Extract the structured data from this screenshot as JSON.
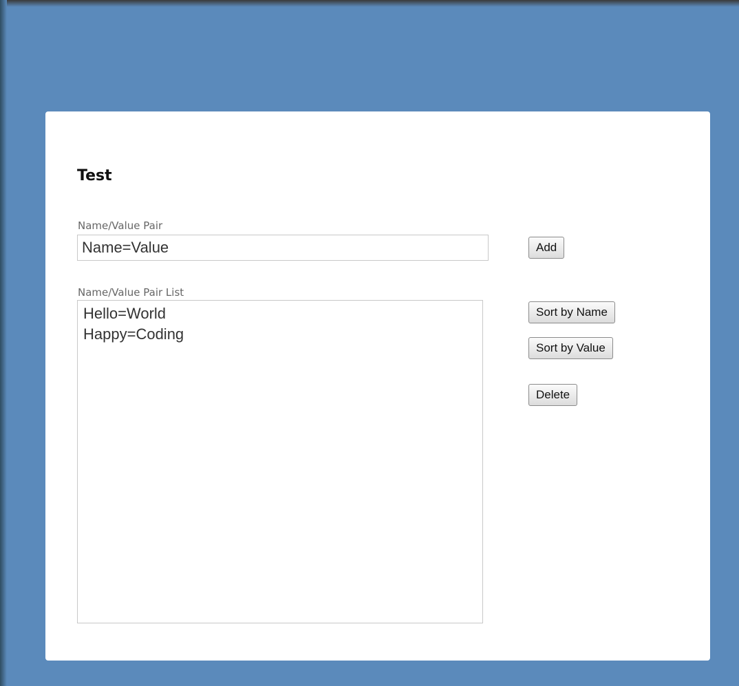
{
  "page": {
    "title": "Test"
  },
  "form": {
    "pair_label": "Name/Value Pair",
    "pair_input_value": "Name=Value",
    "list_label": "Name/Value Pair List",
    "list_items": [
      "Hello=World",
      "Happy=Coding"
    ]
  },
  "buttons": {
    "add": "Add",
    "sort_by_name": "Sort by Name",
    "sort_by_value": "Sort by Value",
    "delete": "Delete"
  },
  "colors": {
    "background": "#5b8abb",
    "card": "#ffffff"
  }
}
